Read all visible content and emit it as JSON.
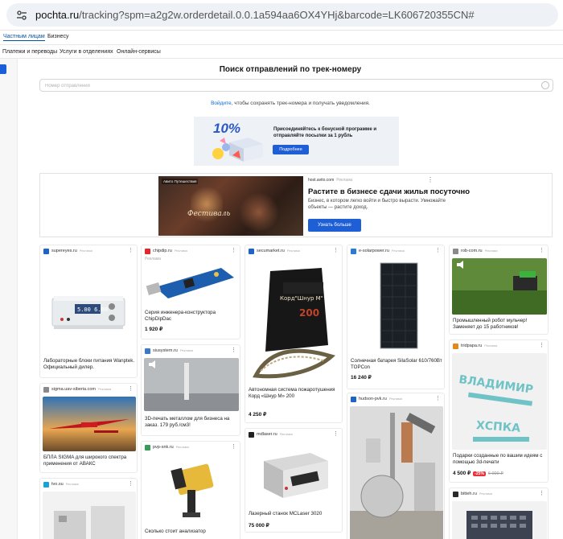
{
  "browser": {
    "url_host": "pochta.ru",
    "url_path": "/tracking?spm=a2g2w.orderdetail.0.0.1a594aa6OX4YHj&barcode=LK606720355CN#"
  },
  "nav": {
    "top": [
      "Частным лицам",
      "Бизнесу"
    ],
    "sub": [
      "Платежи и переводы",
      "Услуги в отделениях",
      "Онлайн-сервисы"
    ]
  },
  "tracking": {
    "heading": "Поиск отправлений по трек-номеру",
    "placeholder": "Номер отправления",
    "login_link": "Войдите",
    "login_rest": ", чтобы сохранять трек-номера и получать уведомления."
  },
  "bonus": {
    "percent": "10%",
    "text": "Присоединяйтесь к бонусной программе и отправляйте посылки за 1 рубль",
    "button": "Подробнее"
  },
  "wide_ad": {
    "image_tag": "Авито Путешествия",
    "image_script": "Фестиваль",
    "host": "host.avito.com",
    "ad_label": "Реклама",
    "title": "Растите в бизнесе сдачи жилья посуточно",
    "desc": "Бизнес, в котором легко войти и быстро вырасти. Умножайте объекты — растите доход.",
    "button": "Узнать больше"
  },
  "cards": [
    {
      "host": "supereyes.ru",
      "ad": "Реклама",
      "title": "Лабораторные блоки питания Wanptek. Официальный дилер.",
      "price": "",
      "display": "5.00 6.00"
    },
    {
      "host": "sigma.uav-siberia.com",
      "ad": "Реклама",
      "title": "БПЛА SIGMA для широкого спектра применения от АВАКС",
      "price": ""
    },
    {
      "host": "tvo.su",
      "ad": "Реклама",
      "title": "",
      "price": ""
    },
    {
      "host": "chipdip.ru",
      "ad": "Реклама",
      "sub": "Реклама",
      "title": "Серия инженера-конструктора ChipDipDac",
      "price": "1 920 ₽"
    },
    {
      "host": "siusystem.ru",
      "ad": "Реклама",
      "title": "3D-печать металлом для бизнеса на заказ. 179 руб./см3!",
      "price": ""
    },
    {
      "host": "pvp-snk.ru",
      "ad": "Реклама",
      "title": "Сколько стоит анализатор",
      "price": ""
    },
    {
      "host": "secumarket.ru",
      "ad": "Реклама",
      "title": "Автономная система пожаротушения Корд «Шнур М» 200",
      "price": "4 250 ₽",
      "label": "Корд\"Шнур М\"",
      "label_num": "200"
    },
    {
      "host": "mdlaser.ru",
      "ad": "Реклама",
      "title": "Лазерный станок MCLaser 3020",
      "price": "75 000 ₽"
    },
    {
      "host": "e-solarpower.ru",
      "ad": "Реклама",
      "title": "Солнечная батарея SilaSolar 610/760Вт TOPCon",
      "price": "16 240 ₽"
    },
    {
      "host": "hudson-pvk.ru",
      "ad": "Реклама",
      "title": "",
      "price": ""
    },
    {
      "host": "rob-com.ru",
      "ad": "Реклама",
      "title": "Промышленный робот мульчер! Заменяет до 15 работников!",
      "price": ""
    },
    {
      "host": "tridpapa.ru",
      "ad": "Реклама",
      "title": "Подарки созданные по вашим идеям с помощью 3d-печати",
      "price": "4 500 ₽",
      "sale": "-25%",
      "old": "6 000 ₽",
      "sign_top": "ВЛАДИМИР",
      "sign_bottom": "ХСПКА"
    },
    {
      "host": "bitteh.ru",
      "ad": "Реклама",
      "title": "",
      "price": ""
    }
  ],
  "colors": {
    "accent": "#1f5fd6",
    "link": "#0b6bd6",
    "sale": "#e8323c"
  }
}
